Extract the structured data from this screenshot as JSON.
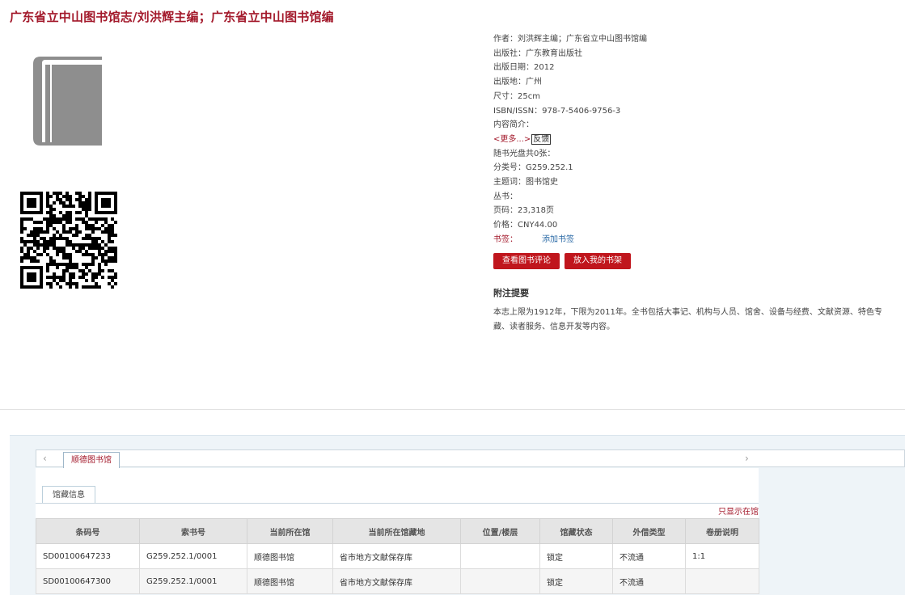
{
  "title": "广东省立中山图书馆志/刘洪辉主编；广东省立中山图书馆编",
  "icons": {
    "cover": "book-icon",
    "qr": "qr-code-icon",
    "prev": "chevron-left-icon",
    "next": "chevron-right-icon"
  },
  "colors": {
    "accent": "#a3192b",
    "button": "#c0161d",
    "link": "#2b6aa6"
  },
  "meta": {
    "author": "作者：刘洪辉主编；广东省立中山图书馆编",
    "publisher": "出版社：广东教育出版社",
    "pub_date": "出版日期：2012",
    "pub_place": "出版地：广州",
    "size": "尺寸：25cm",
    "isbn": "ISBN/ISSN：978-7-5406-9756-3",
    "summary": "内容简介：",
    "more": "<更多...>",
    "feedback": "反馈",
    "cd": "随书光盘共0张：",
    "class_no": "分类号：G259.252.1",
    "subject": "主题词：图书馆史",
    "series": "丛书：",
    "pages": "页码：23,318页",
    "price": "价格：CNY44.00",
    "bookmark_label": "书签：",
    "bookmark_add": "添加书签"
  },
  "buttons": {
    "reviews": "查看图书评论",
    "shelf": "放入我的书架"
  },
  "notes": {
    "title": "附注提要",
    "text": "本志上限为1912年，下限为2011年。全书包括大事记、机构与人员、馆舍、设备与经费、文献资源、特色专藏、读者服务、信息开发等内容。"
  },
  "holdings": {
    "library_tab": "顺德图书馆",
    "subtab": "馆藏信息",
    "only_show": "只显示在馆",
    "columns": [
      "条码号",
      "索书号",
      "当前所在馆",
      "当前所在馆藏地",
      "位置/楼层",
      "馆藏状态",
      "外借类型",
      "卷册说明"
    ],
    "rows": [
      [
        "SD00100647233",
        "G259.252.1/0001",
        "顺德图书馆",
        "省市地方文献保存库",
        "",
        "锁定",
        "不流通",
        "1:1"
      ],
      [
        "SD00100647300",
        "G259.252.1/0001",
        "顺德图书馆",
        "省市地方文献保存库",
        "",
        "锁定",
        "不流通",
        ""
      ]
    ]
  }
}
